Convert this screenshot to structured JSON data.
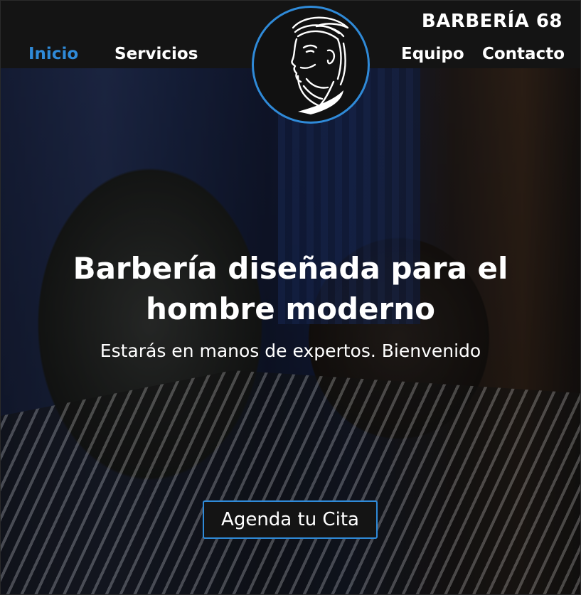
{
  "header": {
    "brand": "BARBERÍA 68",
    "nav": {
      "inicio": "Inicio",
      "servicios": "Servicios",
      "equipo": "Equipo",
      "contacto": "Contacto"
    },
    "active_item": "Inicio"
  },
  "hero": {
    "title_line1": "Barbería diseñada para el",
    "title_line2": "hombre moderno",
    "subtitle": "Estarás en manos de expertos. Bienvenido",
    "cta_label": "Agenda tu Cita"
  },
  "colors": {
    "accent": "#2f8ad8",
    "header_bg": "#141414",
    "text": "#ffffff"
  },
  "icons": {
    "logo": "bearded-man-logo-icon"
  }
}
